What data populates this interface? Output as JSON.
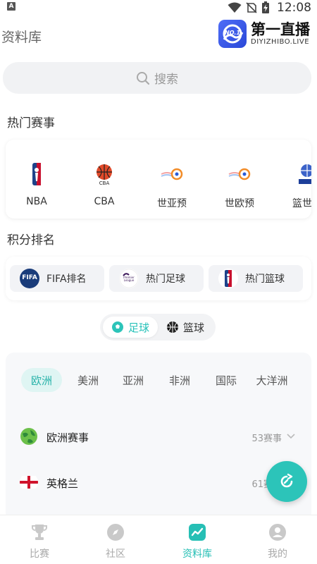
{
  "status_bar": {
    "time": "12:08",
    "app_letter": "A"
  },
  "header": {
    "title": "资料库",
    "logo_name": "第一直播",
    "logo_domain": "DIYIZHIBO.LIVE",
    "logo_badge": "NO.1"
  },
  "search": {
    "placeholder": "搜索"
  },
  "hot_events": {
    "title": "热门赛事",
    "items": [
      {
        "label": "NBA",
        "icon": "nba-logo-icon"
      },
      {
        "label": "CBA",
        "icon": "cba-logo-icon"
      },
      {
        "label": "世亚预",
        "icon": "fiba-asia-icon"
      },
      {
        "label": "世欧预",
        "icon": "fiba-europe-icon"
      },
      {
        "label": "篮世杯",
        "icon": "basketball-world-cup-icon"
      }
    ]
  },
  "rankings": {
    "title": "积分排名",
    "items": [
      {
        "label": "FIFA排名",
        "icon": "fifa-icon",
        "badge": "FIFA"
      },
      {
        "label": "热门足球",
        "icon": "premier-league-icon",
        "badge": "Premier League"
      },
      {
        "label": "热门篮球",
        "icon": "nba-logo-icon"
      }
    ]
  },
  "sport_toggle": {
    "options": [
      {
        "label": "足球",
        "icon": "soccer-ball-icon",
        "active": true
      },
      {
        "label": "篮球",
        "icon": "basketball-icon",
        "active": false
      }
    ]
  },
  "regions": {
    "tabs": [
      "欧洲",
      "美洲",
      "亚洲",
      "非洲",
      "国际",
      "大洋洲"
    ],
    "active": "欧洲",
    "rows": [
      {
        "label": "欧洲赛事",
        "count": "53赛事",
        "icon": "globe-icon"
      },
      {
        "label": "英格兰",
        "count": "61赛事",
        "icon": "england-flag-icon"
      }
    ]
  },
  "bottom_nav": {
    "items": [
      {
        "label": "比赛",
        "icon": "trophy-icon",
        "active": false
      },
      {
        "label": "社区",
        "icon": "compass-icon",
        "active": false
      },
      {
        "label": "资料库",
        "icon": "chart-icon",
        "active": true
      },
      {
        "label": "我的",
        "icon": "user-icon",
        "active": false
      }
    ]
  },
  "colors": {
    "accent": "#2cc4b9",
    "accent_light": "#dff5f3",
    "muted": "#999999"
  }
}
